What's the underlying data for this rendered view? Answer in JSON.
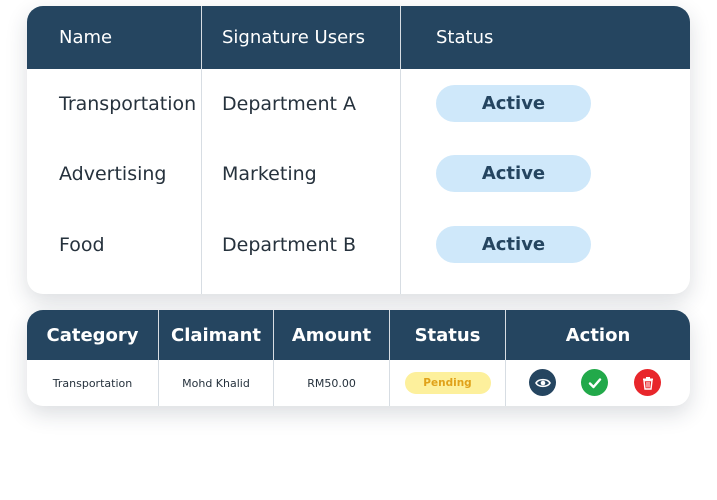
{
  "signature_table": {
    "headers": [
      "Name",
      "Signature Users",
      "Status"
    ],
    "rows": [
      {
        "name": "Transportation",
        "users": "Department A",
        "status": "Active"
      },
      {
        "name": "Advertising",
        "users": "Marketing",
        "status": "Active"
      },
      {
        "name": "Food",
        "users": "Department B",
        "status": "Active"
      }
    ]
  },
  "claims_table": {
    "headers": [
      "Category",
      "Claimant",
      "Amount",
      "Status",
      "Action"
    ],
    "rows": [
      {
        "category": "Transportation",
        "claimant": "Mohd Khalid",
        "amount": "RM50.00",
        "status": "Pending",
        "actions": [
          "eye-icon",
          "check-icon",
          "trash-icon"
        ]
      }
    ]
  },
  "colors": {
    "header_bg": "#254560",
    "active_pill_bg": "#cfe8fa",
    "pending_pill_bg": "#fdf09c",
    "pending_text": "#e0a21a",
    "view_button": "#254560",
    "approve_button": "#22a94a",
    "delete_button": "#e8262b"
  }
}
